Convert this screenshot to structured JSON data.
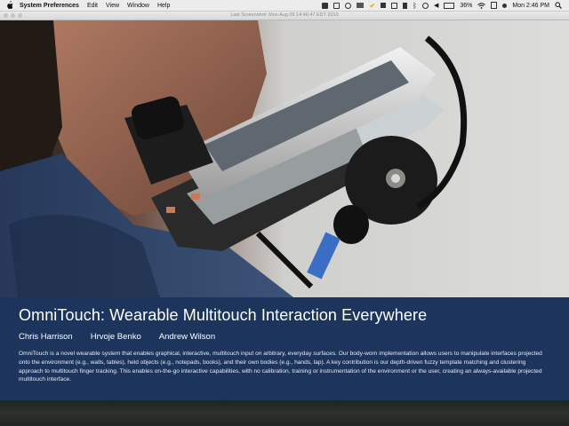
{
  "menubar": {
    "app_name": "System Preferences",
    "menus": [
      "Edit",
      "View",
      "Window",
      "Help"
    ],
    "battery": "36%",
    "clock": "Mon 2:46 PM"
  },
  "titlebar": {
    "title": "Last Screenshot: Mon Aug 09 14:46:47 EDT 2010"
  },
  "caption": {
    "title": "OmniTouch: Wearable Multitouch Interaction Everywhere",
    "authors": [
      "Chris Harrison",
      "Hrvoje Benko",
      "Andrew Wilson"
    ],
    "abstract": "OmniTouch is a novel wearable system that enables graphical, interactive, multitouch input on arbitrary, everyday surfaces. Our body-worn implementation allows users to manipulate interfaces projected onto the environment (e.g., walls, tables), held objects (e.g., notepads, books), and their own bodies (e.g., hands, lap). A key contribution is our depth-driven fuzzy template matching and clustering approach to multitouch finger tracking. This enables on-the-go interactive capabilities, with no calibration, training or instrumentation of the environment or the user, creating an always-available projected multitouch interface."
  },
  "icons": {
    "apple": "apple-icon",
    "wifi": "wifi-icon",
    "bluetooth": "bluetooth-icon",
    "battery": "battery-icon",
    "volume": "volume-icon",
    "search": "spotlight-icon"
  }
}
